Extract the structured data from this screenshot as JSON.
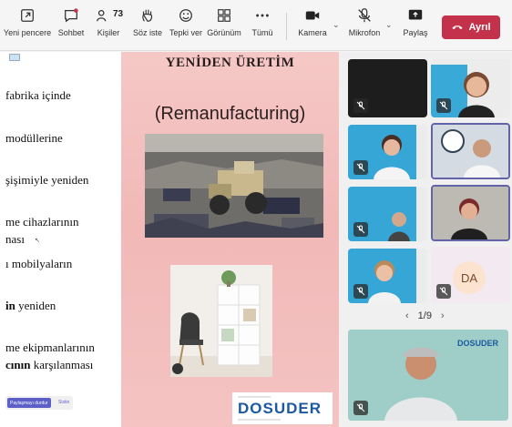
{
  "toolbar": {
    "new_window": "Yeni pencere",
    "chat": "Sohbet",
    "people": "Kişiler",
    "people_count": "73",
    "raise_hand": "Söz iste",
    "react": "Tepki ver",
    "view": "Görünüm",
    "more": "Tümü",
    "camera": "Kamera",
    "mic": "Mikrofon",
    "share": "Paylaş",
    "leave": "Ayrıl"
  },
  "document": {
    "lines": [
      {
        "pre": "",
        "bold": "",
        "text": "fabrika içinde"
      },
      {
        "pre": "",
        "bold": "",
        "text": "modüllerine"
      },
      {
        "pre": "",
        "bold": "",
        "text": "şişimiyle yeniden"
      },
      {
        "pre": "",
        "bold": "",
        "text": "me cihazlarının"
      },
      {
        "pre": "",
        "bold": "",
        "text": "nası"
      },
      {
        "pre": "",
        "bold": "",
        "text": "ı mobilyaların"
      },
      {
        "pre": "",
        "bold": "in",
        "text": " yeniden"
      },
      {
        "pre": "",
        "bold": "",
        "text": "me ekipmanlarının"
      },
      {
        "pre": "",
        "bold": "cının",
        "text": " karşılanması"
      }
    ]
  },
  "slide": {
    "title": "YENİDEN ÜRETİM",
    "subtitle": "(Remanufacturing)",
    "logo_text": "DOSUDER"
  },
  "share_controls": {
    "stop_label": "Paylaşmayı durdur",
    "extra_label": "Sistin"
  },
  "gallery": {
    "avatar_initials": "DA",
    "page": "1/9",
    "big_tile_logo": "DOSUDER"
  },
  "colors": {
    "accent": "#6264a7",
    "leave": "#c4314b",
    "slide_bg": "#f3c2c1"
  }
}
